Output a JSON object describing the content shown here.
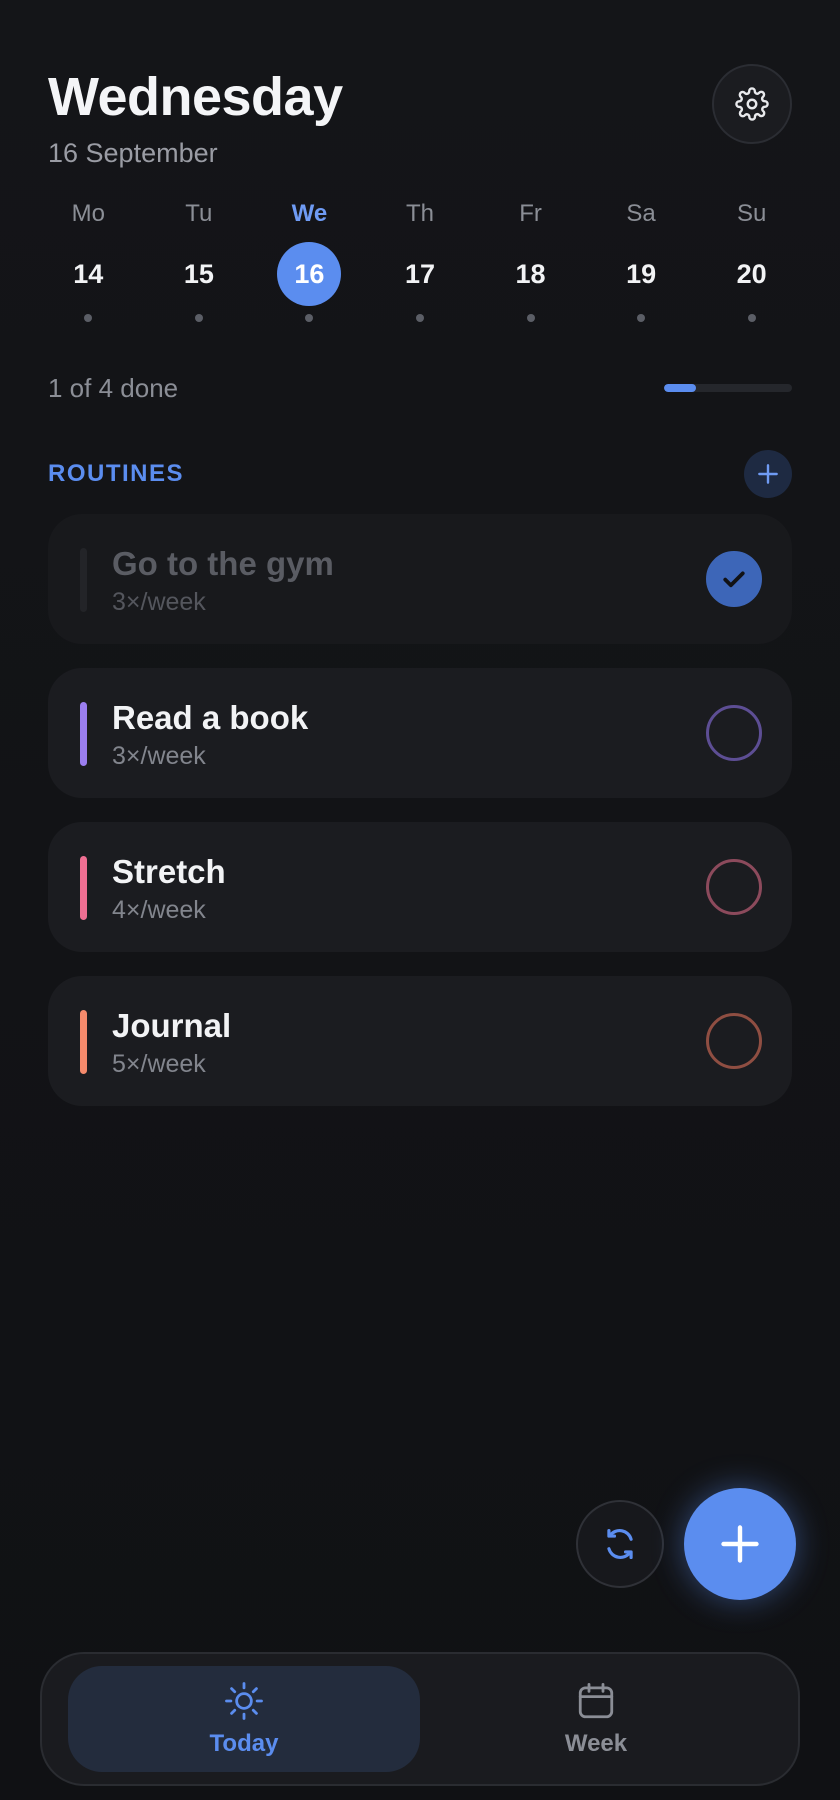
{
  "header": {
    "title": "Wednesday",
    "subtitle": "16 September"
  },
  "week": [
    {
      "name": "Mo",
      "num": "14",
      "active": false
    },
    {
      "name": "Tu",
      "num": "15",
      "active": false
    },
    {
      "name": "We",
      "num": "16",
      "active": true
    },
    {
      "name": "Th",
      "num": "17",
      "active": false
    },
    {
      "name": "Fr",
      "num": "18",
      "active": false
    },
    {
      "name": "Sa",
      "num": "19",
      "active": false
    },
    {
      "name": "Su",
      "num": "20",
      "active": false
    }
  ],
  "progress": {
    "text": "1 of 4 done",
    "done": 1,
    "total": 4
  },
  "routines_section": {
    "title": "ROUTINES"
  },
  "routines": [
    {
      "name": "Go to the gym",
      "freq": "3×/week",
      "done": true,
      "color": "#5b8def"
    },
    {
      "name": "Read a book",
      "freq": "3×/week",
      "done": false,
      "color": "#9b7ef0"
    },
    {
      "name": "Stretch",
      "freq": "4×/week",
      "done": false,
      "color": "#ef6f93"
    },
    {
      "name": "Journal",
      "freq": "5×/week",
      "done": false,
      "color": "#f58a6c"
    }
  ],
  "nav": [
    {
      "label": "Today",
      "icon": "sun-icon",
      "active": true
    },
    {
      "label": "Week",
      "icon": "calendar-icon",
      "active": false
    }
  ],
  "colors": {
    "accent": "#5b8def",
    "background": "#121316",
    "card": "#1b1c20"
  }
}
